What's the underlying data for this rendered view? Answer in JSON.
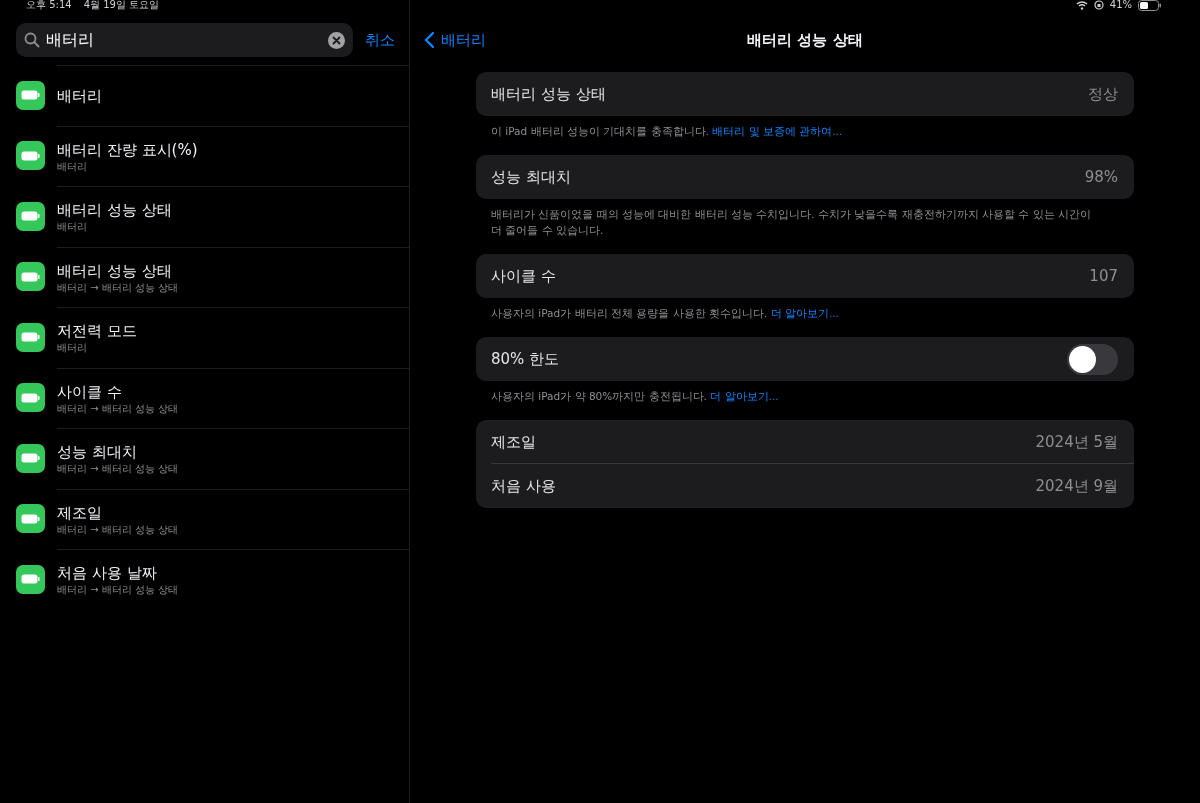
{
  "status_bar": {
    "time": "오후 5:14",
    "date": "4월 19일 토요일",
    "battery_percent": "41%"
  },
  "search": {
    "value": "배터리",
    "cancel": "취소"
  },
  "results": [
    {
      "title": "배터리"
    },
    {
      "title": "배터리 잔량 표시(%)",
      "path": "배터리"
    },
    {
      "title": "배터리 성능 상태",
      "path": "배터리"
    },
    {
      "title": "배터리 성능 상태",
      "path": "배터리 → 배터리 성능 상태"
    },
    {
      "title": "저전력 모드",
      "path": "배터리"
    },
    {
      "title": "사이클 수",
      "path": "배터리 → 배터리 성능 상태"
    },
    {
      "title": "성능 최대치",
      "path": "배터리 → 배터리 성능 상태"
    },
    {
      "title": "제조일",
      "path": "배터리 → 배터리 성능 상태"
    },
    {
      "title": "처음 사용 날짜",
      "path": "배터리 → 배터리 성능 상태"
    }
  ],
  "nav": {
    "back": "배터리",
    "title": "배터리 성능 상태"
  },
  "groups": [
    {
      "rows": [
        {
          "kind": "value",
          "label": "배터리 성능 상태",
          "value": "정상"
        }
      ],
      "footer": {
        "text": "이 iPad 배터리 성능이 기대치를 충족합니다.",
        "link": "배터리 및 보증에 관하여..."
      }
    },
    {
      "rows": [
        {
          "kind": "value",
          "label": "성능 최대치",
          "value": "98%"
        }
      ],
      "footer": {
        "text": "배터리가 신품이었을 때의 성능에 대비한 배터리 성능 수치입니다. 수치가 낮을수록 재충전하기까지 사용할 수 있는 시간이 더 줄어들 수 있습니다."
      }
    },
    {
      "rows": [
        {
          "kind": "value",
          "label": "사이클 수",
          "value": "107"
        }
      ],
      "footer": {
        "text": "사용자의 iPad가 배터리 전체 용량을 사용한 횟수입니다.",
        "link": "더 알아보기..."
      }
    },
    {
      "rows": [
        {
          "kind": "toggle",
          "label": "80% 한도",
          "on": false
        }
      ],
      "footer": {
        "text": "사용자의 iPad가 약 80%까지만 충전됩니다.",
        "link": "더 알아보기..."
      }
    },
    {
      "rows": [
        {
          "kind": "value",
          "label": "제조일",
          "value": "2024년 5월"
        },
        {
          "kind": "value",
          "label": "처음 사용",
          "value": "2024년 9월"
        }
      ]
    }
  ]
}
